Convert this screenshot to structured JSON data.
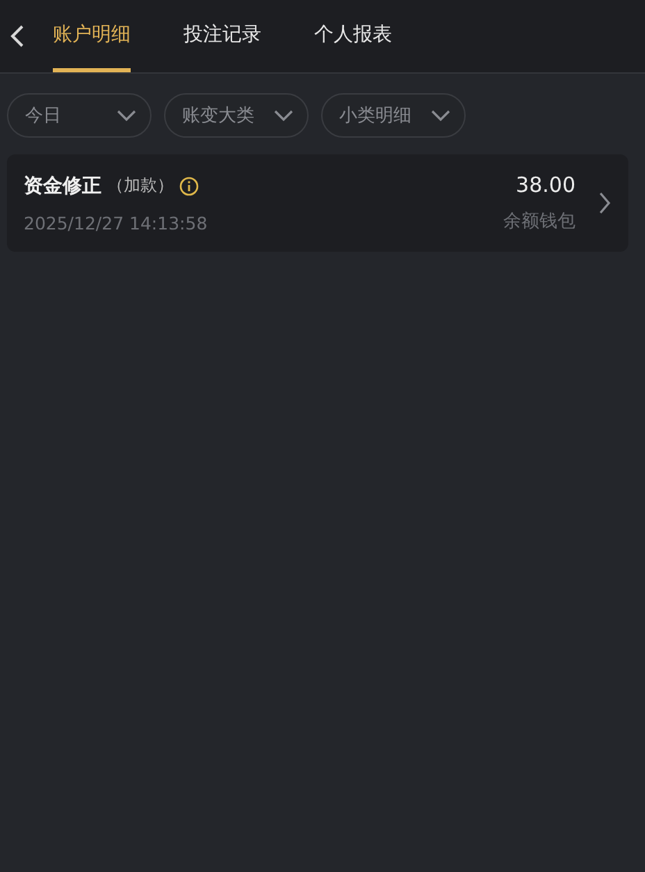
{
  "tabs": [
    {
      "label": "账户明细",
      "selected": true
    },
    {
      "label": "投注记录",
      "selected": false
    },
    {
      "label": "个人报表",
      "selected": false
    }
  ],
  "filters": [
    {
      "label": "今日"
    },
    {
      "label": "账变大类"
    },
    {
      "label": "小类明细"
    }
  ],
  "records": [
    {
      "title": "资金修正",
      "subtitle": "（加款）",
      "time": "2025/12/27 14:13:58",
      "amount": "38.00",
      "wallet": "余额钱包"
    }
  ]
}
